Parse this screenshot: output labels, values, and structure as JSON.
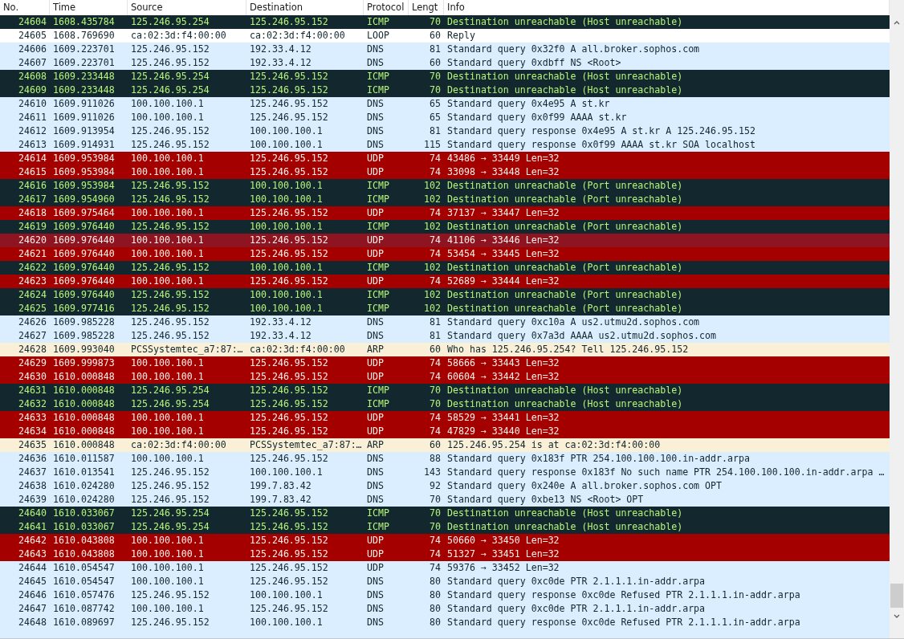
{
  "columns": [
    "No.",
    "Time",
    "Source",
    "Destination",
    "Protocol",
    "Lengt",
    "Info"
  ],
  "rows": [
    {
      "kind": "icmp_error",
      "highlighted": false,
      "cells": [
        "24604",
        "1608.435784",
        "125.246.95.254",
        "125.246.95.152",
        "ICMP",
        "70",
        "Destination unreachable (Host unreachable)"
      ]
    },
    {
      "kind": "plain",
      "highlighted": false,
      "cells": [
        "24605",
        "1608.769690",
        "ca:02:3d:f4:00:00",
        "ca:02:3d:f4:00:00",
        "LOOP",
        "60",
        "Reply"
      ]
    },
    {
      "kind": "normal",
      "highlighted": false,
      "cells": [
        "24606",
        "1609.223701",
        "125.246.95.152",
        "192.33.4.12",
        "DNS",
        "81",
        "Standard query 0x32f0 A all.broker.sophos.com"
      ]
    },
    {
      "kind": "normal",
      "highlighted": false,
      "cells": [
        "24607",
        "1609.223701",
        "125.246.95.152",
        "192.33.4.12",
        "DNS",
        "60",
        "Standard query 0xdbff NS <Root>"
      ]
    },
    {
      "kind": "icmp_error",
      "highlighted": false,
      "cells": [
        "24608",
        "1609.233448",
        "125.246.95.254",
        "125.246.95.152",
        "ICMP",
        "70",
        "Destination unreachable (Host unreachable)"
      ]
    },
    {
      "kind": "icmp_error",
      "highlighted": false,
      "cells": [
        "24609",
        "1609.233448",
        "125.246.95.254",
        "125.246.95.152",
        "ICMP",
        "70",
        "Destination unreachable (Host unreachable)"
      ]
    },
    {
      "kind": "normal",
      "highlighted": false,
      "cells": [
        "24610",
        "1609.911026",
        "100.100.100.1",
        "125.246.95.152",
        "DNS",
        "65",
        "Standard query 0x4e95 A st.kr"
      ]
    },
    {
      "kind": "normal",
      "highlighted": false,
      "cells": [
        "24611",
        "1609.911026",
        "100.100.100.1",
        "125.246.95.152",
        "DNS",
        "65",
        "Standard query 0x0f99 AAAA st.kr"
      ]
    },
    {
      "kind": "normal",
      "highlighted": false,
      "cells": [
        "24612",
        "1609.913954",
        "125.246.95.152",
        "100.100.100.1",
        "DNS",
        "81",
        "Standard query response 0x4e95 A st.kr A 125.246.95.152"
      ]
    },
    {
      "kind": "normal",
      "highlighted": false,
      "cells": [
        "24613",
        "1609.914931",
        "125.246.95.152",
        "100.100.100.1",
        "DNS",
        "115",
        "Standard query response 0x0f99 AAAA st.kr SOA localhost"
      ]
    },
    {
      "kind": "bad",
      "highlighted": false,
      "cells": [
        "24614",
        "1609.953984",
        "100.100.100.1",
        "125.246.95.152",
        "UDP",
        "74",
        "43486 → 33449 Len=32"
      ]
    },
    {
      "kind": "bad",
      "highlighted": false,
      "cells": [
        "24615",
        "1609.953984",
        "100.100.100.1",
        "125.246.95.152",
        "UDP",
        "74",
        "33098 → 33448 Len=32"
      ]
    },
    {
      "kind": "icmp_error",
      "highlighted": false,
      "cells": [
        "24616",
        "1609.953984",
        "125.246.95.152",
        "100.100.100.1",
        "ICMP",
        "102",
        "Destination unreachable (Port unreachable)"
      ]
    },
    {
      "kind": "icmp_error",
      "highlighted": false,
      "cells": [
        "24617",
        "1609.954960",
        "125.246.95.152",
        "100.100.100.1",
        "ICMP",
        "102",
        "Destination unreachable (Port unreachable)"
      ]
    },
    {
      "kind": "bad",
      "highlighted": false,
      "cells": [
        "24618",
        "1609.975464",
        "100.100.100.1",
        "125.246.95.152",
        "UDP",
        "74",
        "37137 → 33447 Len=32"
      ]
    },
    {
      "kind": "icmp_error",
      "highlighted": false,
      "cells": [
        "24619",
        "1609.976440",
        "125.246.95.152",
        "100.100.100.1",
        "ICMP",
        "102",
        "Destination unreachable (Port unreachable)"
      ]
    },
    {
      "kind": "bad",
      "highlighted": true,
      "cells": [
        "24620",
        "1609.976440",
        "100.100.100.1",
        "125.246.95.152",
        "UDP",
        "74",
        "41106 → 33446 Len=32"
      ]
    },
    {
      "kind": "bad",
      "highlighted": false,
      "cells": [
        "24621",
        "1609.976440",
        "100.100.100.1",
        "125.246.95.152",
        "UDP",
        "74",
        "53454 → 33445 Len=32"
      ]
    },
    {
      "kind": "icmp_error",
      "highlighted": false,
      "cells": [
        "24622",
        "1609.976440",
        "125.246.95.152",
        "100.100.100.1",
        "ICMP",
        "102",
        "Destination unreachable (Port unreachable)"
      ]
    },
    {
      "kind": "bad",
      "highlighted": false,
      "cells": [
        "24623",
        "1609.976440",
        "100.100.100.1",
        "125.246.95.152",
        "UDP",
        "74",
        "52689 → 33444 Len=32"
      ]
    },
    {
      "kind": "icmp_error",
      "highlighted": false,
      "cells": [
        "24624",
        "1609.976440",
        "125.246.95.152",
        "100.100.100.1",
        "ICMP",
        "102",
        "Destination unreachable (Port unreachable)"
      ]
    },
    {
      "kind": "icmp_error",
      "highlighted": false,
      "cells": [
        "24625",
        "1609.977416",
        "125.246.95.152",
        "100.100.100.1",
        "ICMP",
        "102",
        "Destination unreachable (Port unreachable)"
      ]
    },
    {
      "kind": "normal",
      "highlighted": false,
      "cells": [
        "24626",
        "1609.985228",
        "125.246.95.152",
        "192.33.4.12",
        "DNS",
        "81",
        "Standard query 0xc10a A us2.utmu2d.sophos.com"
      ]
    },
    {
      "kind": "normal",
      "highlighted": false,
      "cells": [
        "24627",
        "1609.985228",
        "125.246.95.152",
        "192.33.4.12",
        "DNS",
        "81",
        "Standard query 0x7a3d AAAA us2.utmu2d.sophos.com"
      ]
    },
    {
      "kind": "arp",
      "highlighted": false,
      "cells": [
        "24628",
        "1609.993040",
        "PCSSystemtec_a7:87:…",
        "ca:02:3d:f4:00:00",
        "ARP",
        "60",
        "Who has 125.246.95.254? Tell 125.246.95.152"
      ]
    },
    {
      "kind": "bad",
      "highlighted": false,
      "cells": [
        "24629",
        "1609.999873",
        "100.100.100.1",
        "125.246.95.152",
        "UDP",
        "74",
        "58666 → 33443 Len=32"
      ]
    },
    {
      "kind": "bad",
      "highlighted": false,
      "cells": [
        "24630",
        "1610.000848",
        "100.100.100.1",
        "125.246.95.152",
        "UDP",
        "74",
        "60604 → 33442 Len=32"
      ]
    },
    {
      "kind": "icmp_error",
      "highlighted": false,
      "cells": [
        "24631",
        "1610.000848",
        "125.246.95.254",
        "125.246.95.152",
        "ICMP",
        "70",
        "Destination unreachable (Host unreachable)"
      ]
    },
    {
      "kind": "icmp_error",
      "highlighted": false,
      "cells": [
        "24632",
        "1610.000848",
        "125.246.95.254",
        "125.246.95.152",
        "ICMP",
        "70",
        "Destination unreachable (Host unreachable)"
      ]
    },
    {
      "kind": "bad",
      "highlighted": false,
      "cells": [
        "24633",
        "1610.000848",
        "100.100.100.1",
        "125.246.95.152",
        "UDP",
        "74",
        "58529 → 33441 Len=32"
      ]
    },
    {
      "kind": "bad",
      "highlighted": false,
      "cells": [
        "24634",
        "1610.000848",
        "100.100.100.1",
        "125.246.95.152",
        "UDP",
        "74",
        "47829 → 33440 Len=32"
      ]
    },
    {
      "kind": "arp",
      "highlighted": false,
      "cells": [
        "24635",
        "1610.000848",
        "ca:02:3d:f4:00:00",
        "PCSSystemtec_a7:87:…",
        "ARP",
        "60",
        "125.246.95.254 is at ca:02:3d:f4:00:00"
      ]
    },
    {
      "kind": "normal",
      "highlighted": false,
      "cells": [
        "24636",
        "1610.011587",
        "100.100.100.1",
        "125.246.95.152",
        "DNS",
        "88",
        "Standard query 0x183f PTR 254.100.100.100.in-addr.arpa"
      ]
    },
    {
      "kind": "normal",
      "highlighted": false,
      "cells": [
        "24637",
        "1610.013541",
        "125.246.95.152",
        "100.100.100.1",
        "DNS",
        "143",
        "Standard query response 0x183f No such name PTR 254.100.100.100.in-addr.arpa …"
      ]
    },
    {
      "kind": "normal",
      "highlighted": false,
      "cells": [
        "24638",
        "1610.024280",
        "125.246.95.152",
        "199.7.83.42",
        "DNS",
        "92",
        "Standard query 0x240e A all.broker.sophos.com OPT"
      ]
    },
    {
      "kind": "normal",
      "highlighted": false,
      "cells": [
        "24639",
        "1610.024280",
        "125.246.95.152",
        "199.7.83.42",
        "DNS",
        "70",
        "Standard query 0xbe13 NS <Root> OPT"
      ]
    },
    {
      "kind": "icmp_error",
      "highlighted": false,
      "cells": [
        "24640",
        "1610.033067",
        "125.246.95.254",
        "125.246.95.152",
        "ICMP",
        "70",
        "Destination unreachable (Host unreachable)"
      ]
    },
    {
      "kind": "icmp_error",
      "highlighted": false,
      "cells": [
        "24641",
        "1610.033067",
        "125.246.95.254",
        "125.246.95.152",
        "ICMP",
        "70",
        "Destination unreachable (Host unreachable)"
      ]
    },
    {
      "kind": "bad",
      "highlighted": false,
      "cells": [
        "24642",
        "1610.043808",
        "100.100.100.1",
        "125.246.95.152",
        "UDP",
        "74",
        "50660 → 33450 Len=32"
      ]
    },
    {
      "kind": "bad",
      "highlighted": false,
      "cells": [
        "24643",
        "1610.043808",
        "100.100.100.1",
        "125.246.95.152",
        "UDP",
        "74",
        "51327 → 33451 Len=32"
      ]
    },
    {
      "kind": "normal",
      "highlighted": false,
      "cells": [
        "24644",
        "1610.054547",
        "100.100.100.1",
        "125.246.95.152",
        "UDP",
        "74",
        "59376 → 33452 Len=32"
      ]
    },
    {
      "kind": "normal",
      "highlighted": false,
      "cells": [
        "24645",
        "1610.054547",
        "100.100.100.1",
        "125.246.95.152",
        "DNS",
        "80",
        "Standard query 0xc0de PTR 2.1.1.1.in-addr.arpa"
      ]
    },
    {
      "kind": "normal",
      "highlighted": false,
      "cells": [
        "24646",
        "1610.057476",
        "125.246.95.152",
        "100.100.100.1",
        "DNS",
        "80",
        "Standard query response 0xc0de Refused PTR 2.1.1.1.in-addr.arpa"
      ]
    },
    {
      "kind": "normal",
      "highlighted": false,
      "cells": [
        "24647",
        "1610.087742",
        "100.100.100.1",
        "125.246.95.152",
        "DNS",
        "80",
        "Standard query 0xc0de PTR 2.1.1.1.in-addr.arpa"
      ]
    },
    {
      "kind": "normal",
      "highlighted": false,
      "cells": [
        "24648",
        "1610.089697",
        "125.246.95.152",
        "100.100.100.1",
        "DNS",
        "80",
        "Standard query response 0xc0de Refused PTR 2.1.1.1.in-addr.arpa"
      ]
    }
  ]
}
